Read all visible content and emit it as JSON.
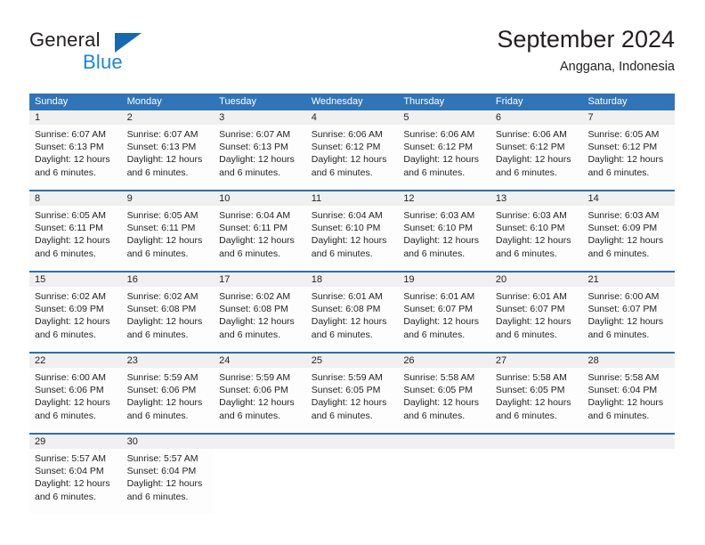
{
  "logo": {
    "word_top": "General",
    "word_bottom": "Blue",
    "triangle_icon": "blue-triangle-icon",
    "brand_color": "#1668b3",
    "blue_text_color": "#1d86d4"
  },
  "header": {
    "title": "September 2024",
    "subtitle": "Anggana, Indonesia"
  },
  "theme": {
    "header_bg": "#3075b8",
    "header_text": "#ffffff",
    "daynum_bg": "#f0f0f0",
    "rule_color": "#2f6eb0",
    "body_text": "#231f20"
  },
  "weekdays": [
    "Sunday",
    "Monday",
    "Tuesday",
    "Wednesday",
    "Thursday",
    "Friday",
    "Saturday"
  ],
  "weeks": [
    {
      "days": [
        {
          "num": "1",
          "sunrise": "Sunrise: 6:07 AM",
          "sunset": "Sunset: 6:13 PM",
          "daylight": "Daylight: 12 hours and 6 minutes."
        },
        {
          "num": "2",
          "sunrise": "Sunrise: 6:07 AM",
          "sunset": "Sunset: 6:13 PM",
          "daylight": "Daylight: 12 hours and 6 minutes."
        },
        {
          "num": "3",
          "sunrise": "Sunrise: 6:07 AM",
          "sunset": "Sunset: 6:13 PM",
          "daylight": "Daylight: 12 hours and 6 minutes."
        },
        {
          "num": "4",
          "sunrise": "Sunrise: 6:06 AM",
          "sunset": "Sunset: 6:12 PM",
          "daylight": "Daylight: 12 hours and 6 minutes."
        },
        {
          "num": "5",
          "sunrise": "Sunrise: 6:06 AM",
          "sunset": "Sunset: 6:12 PM",
          "daylight": "Daylight: 12 hours and 6 minutes."
        },
        {
          "num": "6",
          "sunrise": "Sunrise: 6:06 AM",
          "sunset": "Sunset: 6:12 PM",
          "daylight": "Daylight: 12 hours and 6 minutes."
        },
        {
          "num": "7",
          "sunrise": "Sunrise: 6:05 AM",
          "sunset": "Sunset: 6:12 PM",
          "daylight": "Daylight: 12 hours and 6 minutes."
        }
      ]
    },
    {
      "days": [
        {
          "num": "8",
          "sunrise": "Sunrise: 6:05 AM",
          "sunset": "Sunset: 6:11 PM",
          "daylight": "Daylight: 12 hours and 6 minutes."
        },
        {
          "num": "9",
          "sunrise": "Sunrise: 6:05 AM",
          "sunset": "Sunset: 6:11 PM",
          "daylight": "Daylight: 12 hours and 6 minutes."
        },
        {
          "num": "10",
          "sunrise": "Sunrise: 6:04 AM",
          "sunset": "Sunset: 6:11 PM",
          "daylight": "Daylight: 12 hours and 6 minutes."
        },
        {
          "num": "11",
          "sunrise": "Sunrise: 6:04 AM",
          "sunset": "Sunset: 6:10 PM",
          "daylight": "Daylight: 12 hours and 6 minutes."
        },
        {
          "num": "12",
          "sunrise": "Sunrise: 6:03 AM",
          "sunset": "Sunset: 6:10 PM",
          "daylight": "Daylight: 12 hours and 6 minutes."
        },
        {
          "num": "13",
          "sunrise": "Sunrise: 6:03 AM",
          "sunset": "Sunset: 6:10 PM",
          "daylight": "Daylight: 12 hours and 6 minutes."
        },
        {
          "num": "14",
          "sunrise": "Sunrise: 6:03 AM",
          "sunset": "Sunset: 6:09 PM",
          "daylight": "Daylight: 12 hours and 6 minutes."
        }
      ]
    },
    {
      "days": [
        {
          "num": "15",
          "sunrise": "Sunrise: 6:02 AM",
          "sunset": "Sunset: 6:09 PM",
          "daylight": "Daylight: 12 hours and 6 minutes."
        },
        {
          "num": "16",
          "sunrise": "Sunrise: 6:02 AM",
          "sunset": "Sunset: 6:08 PM",
          "daylight": "Daylight: 12 hours and 6 minutes."
        },
        {
          "num": "17",
          "sunrise": "Sunrise: 6:02 AM",
          "sunset": "Sunset: 6:08 PM",
          "daylight": "Daylight: 12 hours and 6 minutes."
        },
        {
          "num": "18",
          "sunrise": "Sunrise: 6:01 AM",
          "sunset": "Sunset: 6:08 PM",
          "daylight": "Daylight: 12 hours and 6 minutes."
        },
        {
          "num": "19",
          "sunrise": "Sunrise: 6:01 AM",
          "sunset": "Sunset: 6:07 PM",
          "daylight": "Daylight: 12 hours and 6 minutes."
        },
        {
          "num": "20",
          "sunrise": "Sunrise: 6:01 AM",
          "sunset": "Sunset: 6:07 PM",
          "daylight": "Daylight: 12 hours and 6 minutes."
        },
        {
          "num": "21",
          "sunrise": "Sunrise: 6:00 AM",
          "sunset": "Sunset: 6:07 PM",
          "daylight": "Daylight: 12 hours and 6 minutes."
        }
      ]
    },
    {
      "days": [
        {
          "num": "22",
          "sunrise": "Sunrise: 6:00 AM",
          "sunset": "Sunset: 6:06 PM",
          "daylight": "Daylight: 12 hours and 6 minutes."
        },
        {
          "num": "23",
          "sunrise": "Sunrise: 5:59 AM",
          "sunset": "Sunset: 6:06 PM",
          "daylight": "Daylight: 12 hours and 6 minutes."
        },
        {
          "num": "24",
          "sunrise": "Sunrise: 5:59 AM",
          "sunset": "Sunset: 6:06 PM",
          "daylight": "Daylight: 12 hours and 6 minutes."
        },
        {
          "num": "25",
          "sunrise": "Sunrise: 5:59 AM",
          "sunset": "Sunset: 6:05 PM",
          "daylight": "Daylight: 12 hours and 6 minutes."
        },
        {
          "num": "26",
          "sunrise": "Sunrise: 5:58 AM",
          "sunset": "Sunset: 6:05 PM",
          "daylight": "Daylight: 12 hours and 6 minutes."
        },
        {
          "num": "27",
          "sunrise": "Sunrise: 5:58 AM",
          "sunset": "Sunset: 6:05 PM",
          "daylight": "Daylight: 12 hours and 6 minutes."
        },
        {
          "num": "28",
          "sunrise": "Sunrise: 5:58 AM",
          "sunset": "Sunset: 6:04 PM",
          "daylight": "Daylight: 12 hours and 6 minutes."
        }
      ]
    },
    {
      "days": [
        {
          "num": "29",
          "sunrise": "Sunrise: 5:57 AM",
          "sunset": "Sunset: 6:04 PM",
          "daylight": "Daylight: 12 hours and 6 minutes."
        },
        {
          "num": "30",
          "sunrise": "Sunrise: 5:57 AM",
          "sunset": "Sunset: 6:04 PM",
          "daylight": "Daylight: 12 hours and 6 minutes."
        },
        {
          "num": "",
          "sunrise": "",
          "sunset": "",
          "daylight": ""
        },
        {
          "num": "",
          "sunrise": "",
          "sunset": "",
          "daylight": ""
        },
        {
          "num": "",
          "sunrise": "",
          "sunset": "",
          "daylight": ""
        },
        {
          "num": "",
          "sunrise": "",
          "sunset": "",
          "daylight": ""
        },
        {
          "num": "",
          "sunrise": "",
          "sunset": "",
          "daylight": ""
        }
      ]
    }
  ]
}
